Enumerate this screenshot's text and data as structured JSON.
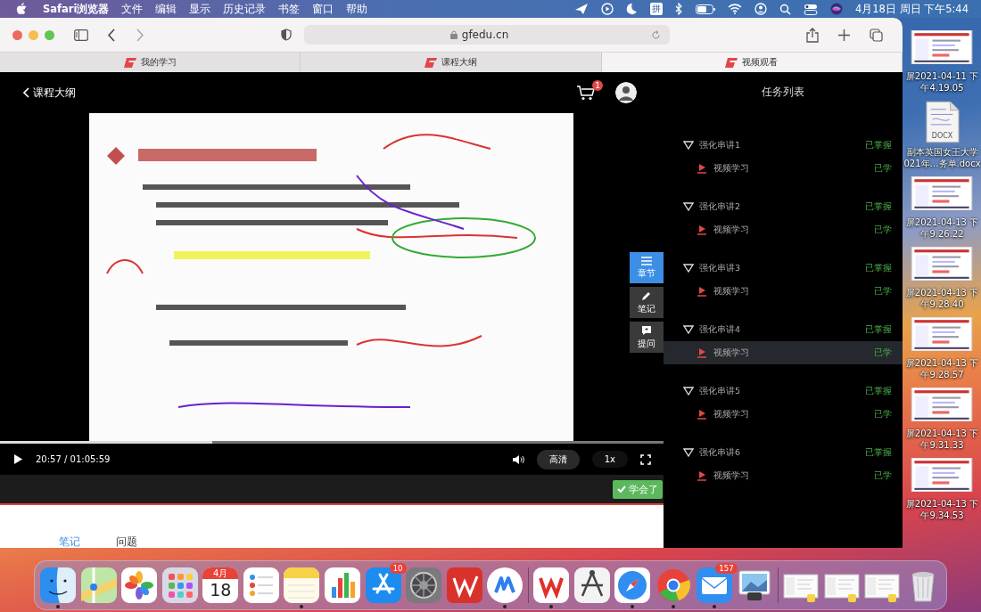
{
  "menu_bar": {
    "menus": [
      "Safari浏览器",
      "文件",
      "编辑",
      "显示",
      "历史记录",
      "书签",
      "窗口",
      "帮助"
    ],
    "input_method": "拼",
    "clock": "4月18日 周日 下午5:44"
  },
  "browser": {
    "address": "gfedu.cn",
    "tabs": [
      {
        "label": "我的学习",
        "selected": false
      },
      {
        "label": "课程大纲",
        "selected": false
      },
      {
        "label": "视频观看",
        "selected": true
      }
    ]
  },
  "page": {
    "back_link": "课程大纲",
    "cart_count": "1",
    "player": {
      "playing": false,
      "time": "20:57 / 01:05:59",
      "quality": "高清",
      "speed": "1x",
      "level": 0.32
    },
    "side_buttons": [
      {
        "kind": "chapters",
        "label": "章节",
        "selected": true
      },
      {
        "kind": "notes",
        "label": "笔记",
        "selected": false
      },
      {
        "kind": "ask",
        "label": "提问",
        "selected": false
      }
    ],
    "learned_button": "学会了",
    "bottom_tabs": [
      {
        "label": "笔记",
        "selected": true
      },
      {
        "label": "问题",
        "selected": false
      }
    ]
  },
  "task_list": {
    "title": "任务列表",
    "sections": [
      {
        "title": "强化串讲1",
        "status": "已掌握",
        "expanded": true,
        "children": [
          {
            "label": "视频学习",
            "status": "已学",
            "selected": false
          }
        ]
      },
      {
        "title": "强化串讲2",
        "status": "已掌握",
        "expanded": true,
        "children": [
          {
            "label": "视频学习",
            "status": "已学",
            "selected": false
          }
        ]
      },
      {
        "title": "强化串讲3",
        "status": "已掌握",
        "expanded": true,
        "children": [
          {
            "label": "视频学习",
            "status": "已学",
            "selected": false
          }
        ]
      },
      {
        "title": "强化串讲4",
        "status": "已掌握",
        "expanded": true,
        "children": [
          {
            "label": "视频学习",
            "status": "已学",
            "selected": true
          }
        ]
      },
      {
        "title": "强化串讲5",
        "status": "已掌握",
        "expanded": true,
        "children": [
          {
            "label": "视频学习",
            "status": "已学",
            "selected": false
          }
        ]
      },
      {
        "title": "强化串讲6",
        "status": "已掌握",
        "expanded": true,
        "children": [
          {
            "label": "视频学习",
            "status": "已学",
            "selected": false
          }
        ]
      }
    ]
  },
  "desktop_icons": [
    {
      "kind": "screenshot",
      "lines": [
        "屏2021-04-11 下",
        "午4.19.05"
      ]
    },
    {
      "kind": "document",
      "badge": "DOCX",
      "lines": [
        "副本英国女王大学",
        "021年…务单.docx"
      ]
    },
    {
      "kind": "screenshot",
      "lines": [
        "屏2021-04-13 下",
        "午9.26.22"
      ]
    },
    {
      "kind": "screenshot",
      "lines": [
        "屏2021-04-13 下",
        "午9.28.40"
      ]
    },
    {
      "kind": "screenshot",
      "lines": [
        "屏2021-04-13 下",
        "午9.28.57"
      ]
    },
    {
      "kind": "screenshot",
      "lines": [
        "屏2021-04-13 下",
        "午9.31.33"
      ]
    },
    {
      "kind": "screenshot",
      "lines": [
        "屏2021-04-13 下",
        "午9.34.53"
      ]
    }
  ],
  "dock": {
    "items": [
      {
        "kind": "finder",
        "running": true
      },
      {
        "kind": "maps",
        "running": false
      },
      {
        "kind": "photos",
        "running": false
      },
      {
        "kind": "launchpad",
        "running": false
      },
      {
        "kind": "calendar",
        "month": "4月",
        "day": "18",
        "running": false
      },
      {
        "kind": "reminders",
        "running": false
      },
      {
        "kind": "notes",
        "running": true
      },
      {
        "kind": "numbers",
        "running": false
      },
      {
        "kind": "appstore",
        "badge": "10",
        "running": false
      },
      {
        "kind": "settings",
        "running": false
      },
      {
        "kind": "writer",
        "running": false
      },
      {
        "kind": "drops",
        "running": true
      },
      {
        "kind": "separator"
      },
      {
        "kind": "wps",
        "running": true
      },
      {
        "kind": "caliper",
        "running": false
      },
      {
        "kind": "safari",
        "running": true
      },
      {
        "kind": "chrome",
        "running": true
      },
      {
        "kind": "mail",
        "badge": "157",
        "running": true
      },
      {
        "kind": "preview",
        "running": false
      },
      {
        "kind": "separator"
      },
      {
        "kind": "window",
        "running": false
      },
      {
        "kind": "window",
        "running": false
      },
      {
        "kind": "window",
        "running": false
      },
      {
        "kind": "trash",
        "running": false
      }
    ]
  }
}
